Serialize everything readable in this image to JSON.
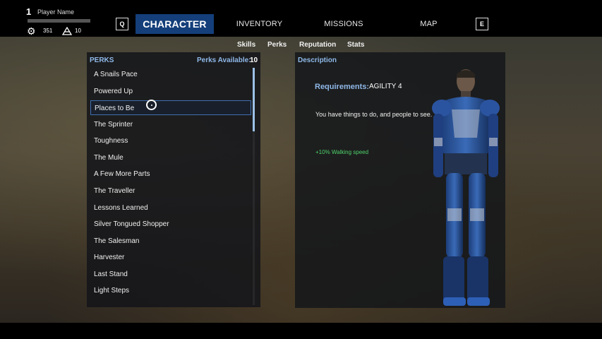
{
  "player": {
    "level": "1",
    "name": "Player Name",
    "stat1_icon": "gear-icon",
    "stat1_value": "351",
    "stat2_icon": "pyramid-icon",
    "stat2_value": "10"
  },
  "nav": {
    "left_key": "Q",
    "right_key": "E",
    "tabs": [
      {
        "label": "CHARACTER",
        "active": true
      },
      {
        "label": "INVENTORY",
        "active": false
      },
      {
        "label": "MISSIONS",
        "active": false
      },
      {
        "label": "MAP",
        "active": false
      }
    ]
  },
  "subnav": [
    "Skills",
    "Perks",
    "Reputation",
    "Stats"
  ],
  "perks": {
    "title": "PERKS",
    "available_label": "Perks Available:",
    "available_value": "10",
    "selected_index": 2,
    "items": [
      "A Snails Pace",
      "Powered Up",
      "Places to Be",
      "The Sprinter",
      "Toughness",
      "The Mule",
      "A Few More Parts",
      "The Traveller",
      "Lessons Learned",
      "Silver Tongued Shopper",
      "The Salesman",
      "Harvester",
      "Last Stand",
      "Light Steps"
    ]
  },
  "description": {
    "title": "Description",
    "requirements_label": "Requirements:",
    "requirements_value": "AGILITY  4",
    "text": "You have things to do, and people to see.",
    "effect": "+10% Walking speed"
  },
  "colors": {
    "accent": "#143f7a",
    "heading": "#8fb8e8",
    "effect": "#4fd36a"
  }
}
